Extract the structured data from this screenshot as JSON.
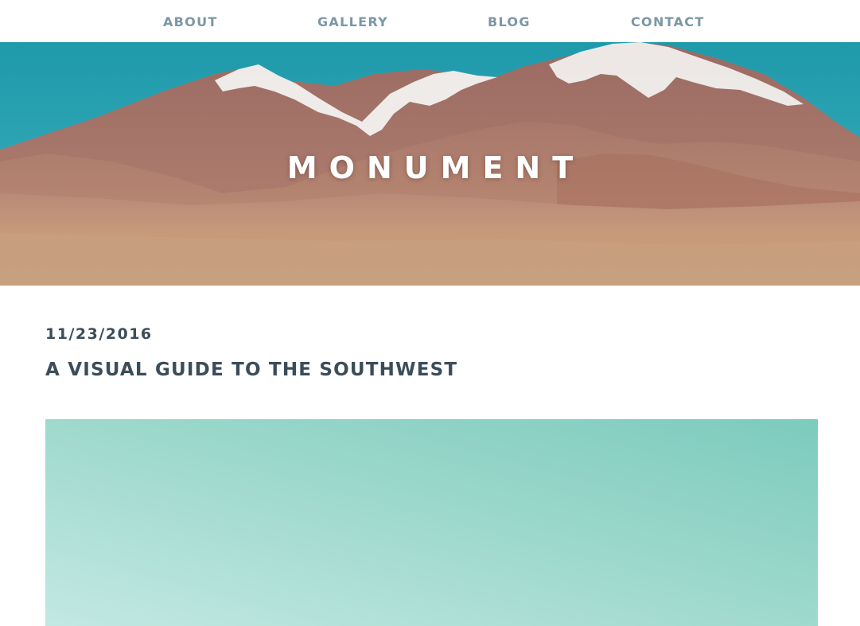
{
  "nav": {
    "items": [
      {
        "label": "ABOUT"
      },
      {
        "label": "GALLERY"
      },
      {
        "label": "BLOG"
      },
      {
        "label": "CONTACT"
      }
    ]
  },
  "hero": {
    "title": "MONUMENT"
  },
  "post": {
    "date": "11/23/2016",
    "title": "A VISUAL GUIDE TO THE SOUTHWEST"
  },
  "colors": {
    "nav_link": "#7b97a6",
    "heading": "#3b4d5a",
    "sky": "#2aa3b3",
    "post_image_teal": "#8fd3c6"
  }
}
